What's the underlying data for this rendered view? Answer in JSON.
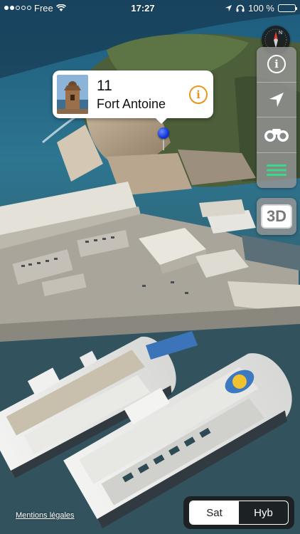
{
  "status_bar": {
    "carrier": "Free",
    "time": "17:27",
    "battery_percent": "100 %",
    "battery_level": 1.0,
    "icons": [
      "signal-dots-icon",
      "wifi-icon",
      "location-arrow-icon",
      "headphones-icon",
      "battery-icon"
    ]
  },
  "callout": {
    "number": "11",
    "title": "Fort Antoine",
    "info_icon": "i"
  },
  "toolbar": {
    "items": [
      "info-icon",
      "location-arrow-icon",
      "binoculars-icon",
      "menu-lines-icon"
    ],
    "info_glyph": "i",
    "mode_3d_label": "3D"
  },
  "footer": {
    "legal_link": "Mentions légales",
    "map_types": [
      "Sat",
      "Hyb"
    ],
    "selected_map_type": "Sat"
  },
  "colors": {
    "accent_orange": "#e8961e",
    "pin_blue": "#1034d8",
    "menu_green": "#39d98a"
  }
}
